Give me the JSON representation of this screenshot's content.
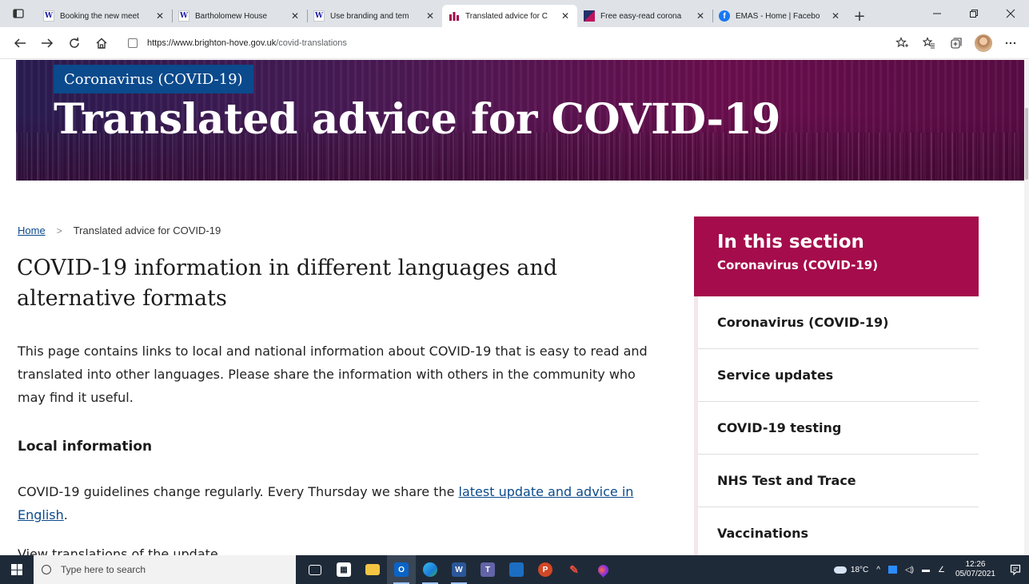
{
  "browser": {
    "tabs": [
      {
        "title": "Booking the new meet",
        "favicon": "w-icon",
        "active": false
      },
      {
        "title": "Bartholomew House",
        "favicon": "w-icon",
        "active": false
      },
      {
        "title": "Use branding and tem",
        "favicon": "w-icon",
        "active": false
      },
      {
        "title": "Translated advice for C",
        "favicon": "bh-icon",
        "active": true
      },
      {
        "title": "Free easy-read corona",
        "favicon": "flag-icon",
        "active": false
      },
      {
        "title": "EMAS - Home | Facebo",
        "favicon": "facebook-icon",
        "active": false
      }
    ],
    "close_glyph": "✕",
    "new_tab_glyph": "+",
    "url_host": "https://www.brighton-hove.gov.uk",
    "url_path": "/covid-translations"
  },
  "page": {
    "hero": {
      "tag": "Coronavirus (COVID-19)",
      "title": "Translated advice for COVID-19"
    },
    "breadcrumb": {
      "home": "Home",
      "separator": ">",
      "current": "Translated advice for COVID-19"
    },
    "title": "COVID-19 information in different languages and alternative formats",
    "intro": "This page contains links to local and national information about COVID-19 that is easy to read and translated into other languages. Please share the information with others in the community who may find it useful.",
    "local_heading": "Local information",
    "local_text": "COVID-19 guidelines change regularly. Every Thursday we share the ",
    "local_link": "latest update and advice in English",
    "local_end": ".",
    "cut_text": "View translations of the update.                  ",
    "sidenav": {
      "heading": "In this section",
      "subheading": "Coronavirus (COVID-19)",
      "items": [
        "Coronavirus (COVID-19)",
        "Service updates",
        "COVID-19 testing",
        "NHS Test and Trace",
        "Vaccinations"
      ]
    },
    "colors": {
      "brand": "#a50c4b",
      "link": "#0b4a8c",
      "tag": "#0b4a8c"
    }
  },
  "taskbar": {
    "search_placeholder": "Type here to search",
    "weather": "18°C",
    "time": "12:26",
    "date": "05/07/2021"
  }
}
